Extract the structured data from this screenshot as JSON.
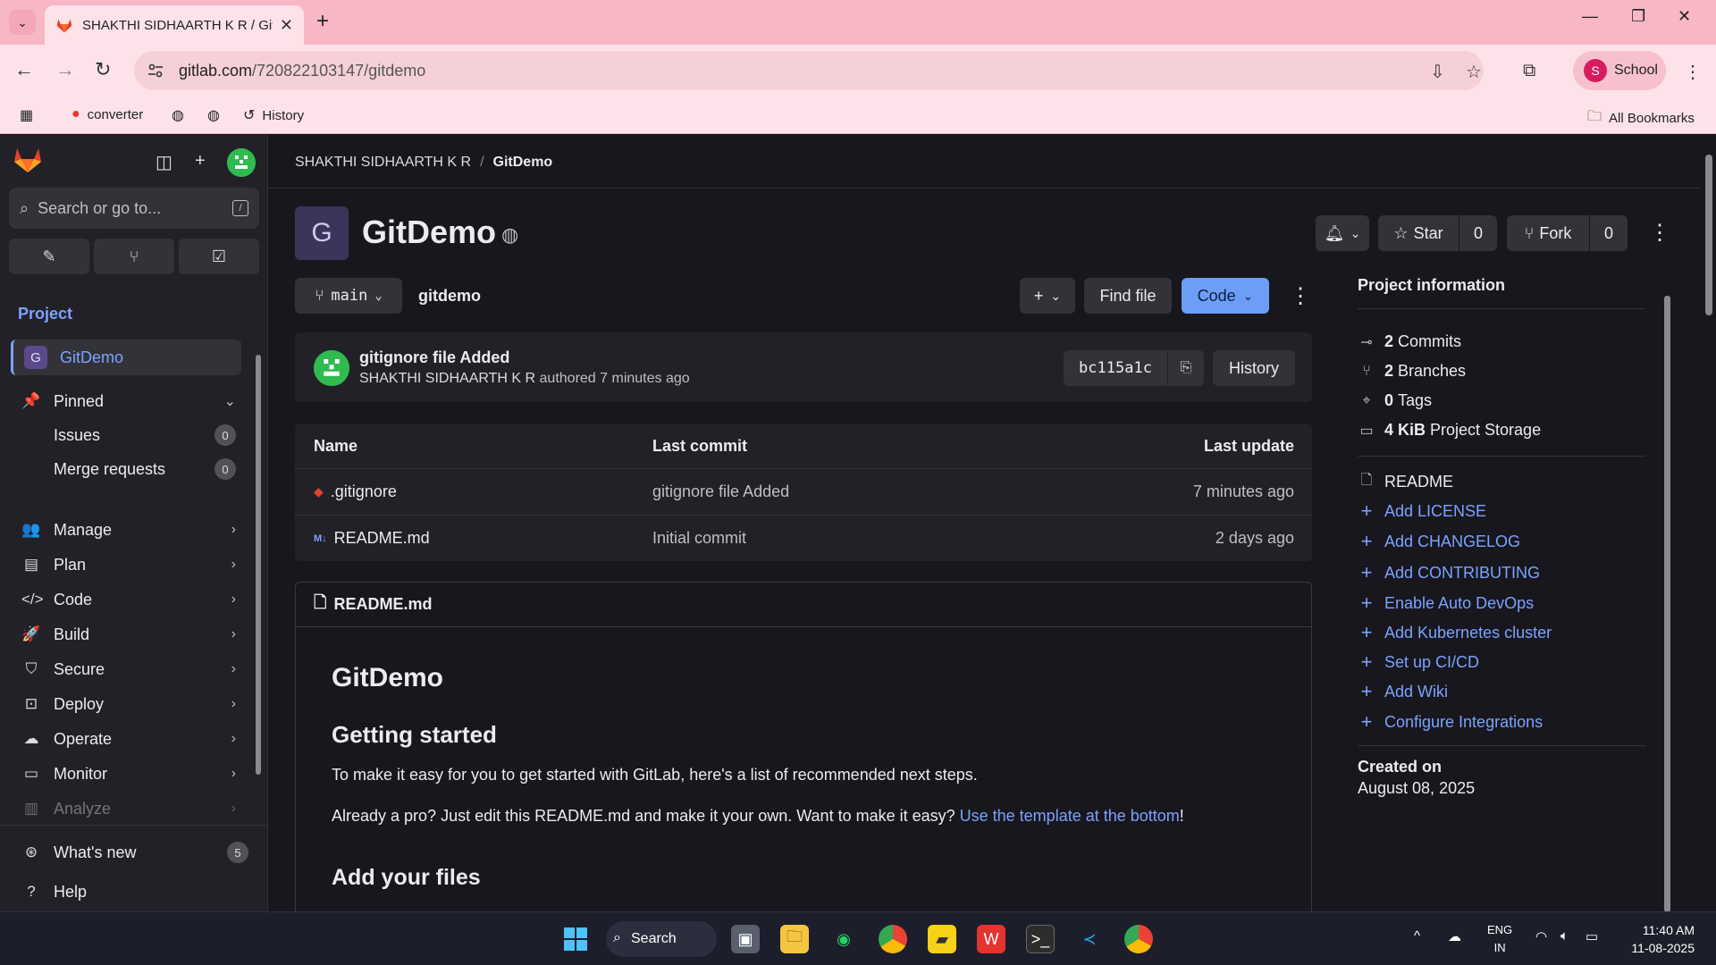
{
  "browser": {
    "tab_title": "SHAKTHI SIDHAARTH K R / GitL",
    "url_host": "gitlab.com",
    "url_path": "/720822103147/gitdemo",
    "profile_initial": "S",
    "profile_name": "School",
    "bookmarks": [
      {
        "label": "converter"
      },
      {
        "label": ""
      },
      {
        "label": ""
      },
      {
        "label": "History"
      }
    ],
    "all_bookmarks": "All Bookmarks"
  },
  "sidebar": {
    "search_placeholder": "Search or go to...",
    "search_kbd": "/",
    "section": "Project",
    "project_initial": "G",
    "project_name": "GitDemo",
    "pinned_label": "Pinned",
    "pinned_items": [
      {
        "label": "Issues",
        "count": "0"
      },
      {
        "label": "Merge requests",
        "count": "0"
      }
    ],
    "nav": [
      {
        "label": "Manage",
        "icon": "users-icon"
      },
      {
        "label": "Plan",
        "icon": "calendar-icon"
      },
      {
        "label": "Code",
        "icon": "code-icon"
      },
      {
        "label": "Build",
        "icon": "rocket-icon"
      },
      {
        "label": "Secure",
        "icon": "shield-icon"
      },
      {
        "label": "Deploy",
        "icon": "deploy-icon"
      },
      {
        "label": "Operate",
        "icon": "cloud-icon"
      },
      {
        "label": "Monitor",
        "icon": "monitor-icon"
      },
      {
        "label": "Analyze",
        "icon": "chart-icon"
      }
    ],
    "whats_new": "What's new",
    "whats_new_count": "5",
    "help": "Help"
  },
  "breadcrumb": {
    "owner": "SHAKTHI SIDHAARTH K R",
    "project": "GitDemo"
  },
  "project": {
    "avatar_letter": "G",
    "title": "GitDemo",
    "star_label": "Star",
    "star_count": "0",
    "fork_label": "Fork",
    "fork_count": "0"
  },
  "repo": {
    "branch": "main",
    "path": "gitdemo",
    "find_file": "Find file",
    "code_label": "Code",
    "commit": {
      "message": "gitignore file Added",
      "author": "SHAKTHI SIDHAARTH K R",
      "time_text": "authored 7 minutes ago",
      "sha": "bc115a1c",
      "history_label": "History"
    },
    "table_headers": [
      "Name",
      "Last commit",
      "Last update"
    ],
    "files": [
      {
        "name": ".gitignore",
        "commit": "gitignore file Added",
        "updated": "7 minutes ago",
        "icon": "git-icon",
        "icon_color": "#e24329"
      },
      {
        "name": "README.md",
        "commit": "Initial commit",
        "updated": "2 days ago",
        "icon": "markdown-icon",
        "icon_color": "#7ba3ff"
      }
    ]
  },
  "readme": {
    "file_label": "README.md",
    "h1": "GitDemo",
    "h2_started": "Getting started",
    "p1": "To make it easy for you to get started with GitLab, here's a list of recommended next steps.",
    "p2_prefix": "Already a pro? Just edit this README.md and make it your own. Want to make it easy? ",
    "p2_link": "Use the template at the bottom",
    "p2_suffix": "!",
    "h2_files": "Add your files"
  },
  "project_info": {
    "title": "Project information",
    "commits_count": "2",
    "commits_label": "Commits",
    "branches_count": "2",
    "branches_label": "Branches",
    "tags_count": "0",
    "tags_label": "Tags",
    "storage_size": "4 KiB",
    "storage_label": "Project Storage",
    "readme": "README",
    "links": [
      "Add LICENSE",
      "Add CHANGELOG",
      "Add CONTRIBUTING",
      "Enable Auto DevOps",
      "Add Kubernetes cluster",
      "Set up CI/CD",
      "Add Wiki",
      "Configure Integrations"
    ],
    "created_label": "Created on",
    "created_date": "August 08, 2025"
  },
  "taskbar": {
    "search_label": "Search",
    "lang_top": "ENG",
    "lang_bottom": "IN",
    "time": "11:40 AM",
    "date": "11-08-2025"
  },
  "colors": {
    "accent_blue": "#7ba3ff",
    "gitlab_orange": "#e24329",
    "chrome_pink": "#f8b7c5"
  }
}
